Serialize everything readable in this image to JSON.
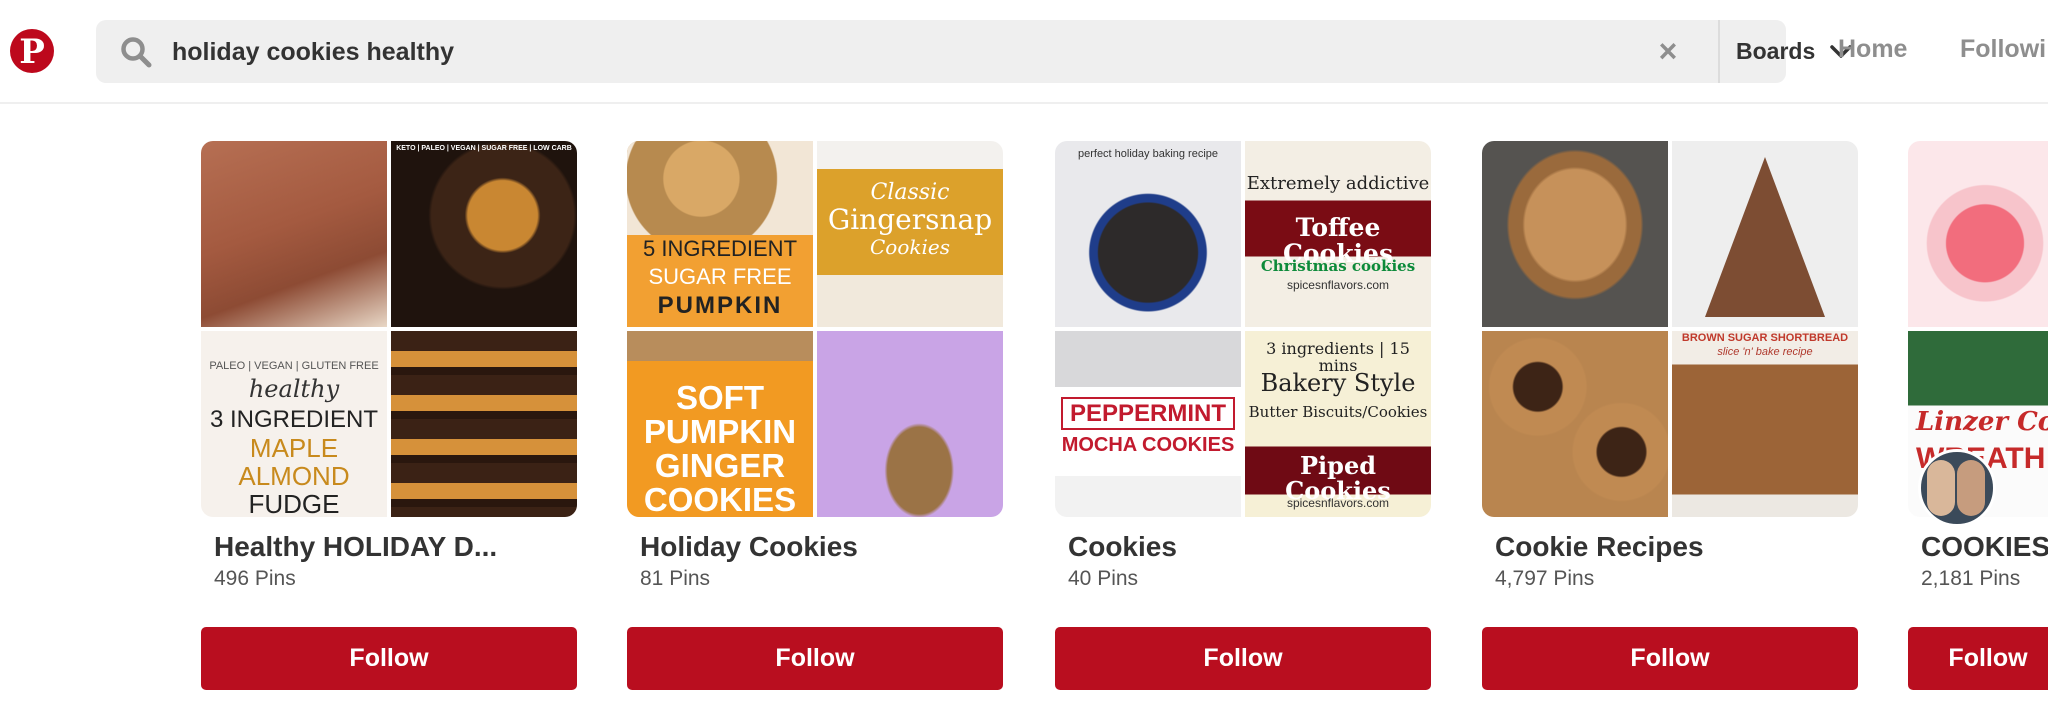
{
  "header": {
    "search_query": "holiday cookies healthy",
    "search_scope": "Boards",
    "nav": {
      "home": "Home",
      "following": "Followi"
    },
    "logo_letter": "P"
  },
  "boards": [
    {
      "title": "Healthy HOLIDAY D...",
      "pins": "496 Pins",
      "follow_label": "Follow",
      "tile_text": {
        "t1_top": "KETO | PALEO | VEGAN | SUGAR FREE | LOW CARB",
        "t2_top": "PALEO | VEGAN | GLUTEN FREE",
        "t2_line1": "healthy",
        "t2_line2": "3 INGREDIENT",
        "t2_line3": "MAPLE",
        "t2_line4": "ALMOND",
        "t2_line5": "FUDGE"
      }
    },
    {
      "title": "Holiday Cookies",
      "pins": "81 Pins",
      "follow_label": "Follow",
      "tile_text": {
        "t0_line1": "5 INGREDIENT",
        "t0_line2": "SUGAR FREE",
        "t0_line3": "PUMPKIN",
        "t1_line1": "Classic",
        "t1_line2": "Gingersnap",
        "t1_line3": "Cookies",
        "t2_line1": "SOFT",
        "t2_line2": "PUMPKIN",
        "t2_line3": "GINGER",
        "t2_line4": "COOKIES"
      }
    },
    {
      "title": "Cookies",
      "pins": "40 Pins",
      "follow_label": "Follow",
      "tile_text": {
        "t0_top": "perfect holiday baking recipe",
        "t1_line1": "Extremely addictive",
        "t1_line2": "Toffee Cookies",
        "t1_line3": "Christmas cookies",
        "t1_line4": "spicesnflavors.com",
        "t2_line1": "PEPPERMINT",
        "t2_line2": "MOCHA COOKIES",
        "t3_line1": "3 ingredients | 15 mins",
        "t3_line2": "Bakery Style",
        "t3_line3": "Butter Biscuits/Cookies",
        "t3_line4": "Piped Cookies",
        "t3_line5": "spicesnflavors.com"
      }
    },
    {
      "title": "Cookie Recipes",
      "pins": "4,797 Pins",
      "follow_label": "Follow",
      "tile_text": {
        "t3_line1": "BROWN SUGAR SHORTBREAD",
        "t3_line2": "slice 'n' bake recipe"
      }
    },
    {
      "title": "COOKIES",
      "pins": "2,181 Pins",
      "follow_label": "Follow",
      "tile_text": {
        "t2_line1": "Linzer Coo",
        "t2_line2": "WREATH"
      }
    }
  ],
  "colors": {
    "brand_red": "#bd081c",
    "follow_red": "#b90e1f",
    "search_bg": "#efefef"
  },
  "icons": {
    "logo": "pinterest-logo-icon",
    "search": "search-icon",
    "clear": "close-icon",
    "scope": "chevron-down-icon"
  }
}
